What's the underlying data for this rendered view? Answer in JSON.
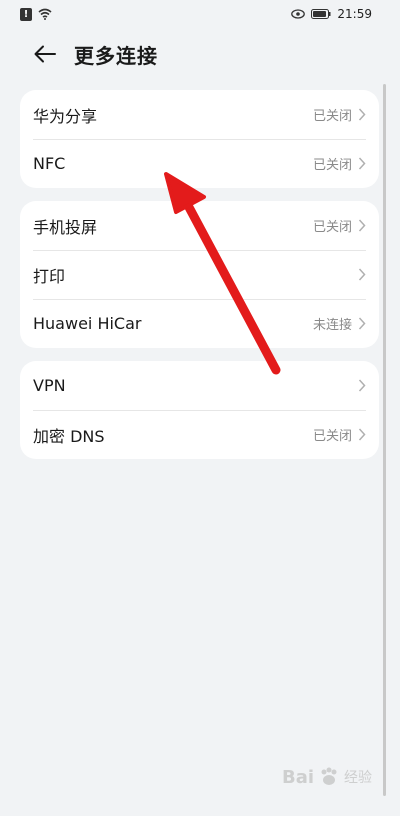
{
  "status_bar": {
    "time": "21:59"
  },
  "header": {
    "title": "更多连接"
  },
  "groups": [
    {
      "items": [
        {
          "label": "华为分享",
          "status": "已关闭"
        },
        {
          "label": "NFC",
          "status": "已关闭"
        }
      ]
    },
    {
      "items": [
        {
          "label": "手机投屏",
          "status": "已关闭"
        },
        {
          "label": "打印",
          "status": ""
        },
        {
          "label": "Huawei HiCar",
          "status": "未连接"
        }
      ]
    },
    {
      "items": [
        {
          "label": "VPN",
          "status": ""
        },
        {
          "label": "加密 DNS",
          "status": "已关闭"
        }
      ]
    }
  ],
  "watermark": {
    "brand": "Bai",
    "brand2": "经验"
  },
  "colors": {
    "background": "#f1f3f5",
    "card": "#ffffff",
    "arrow": "#e31b1b"
  }
}
